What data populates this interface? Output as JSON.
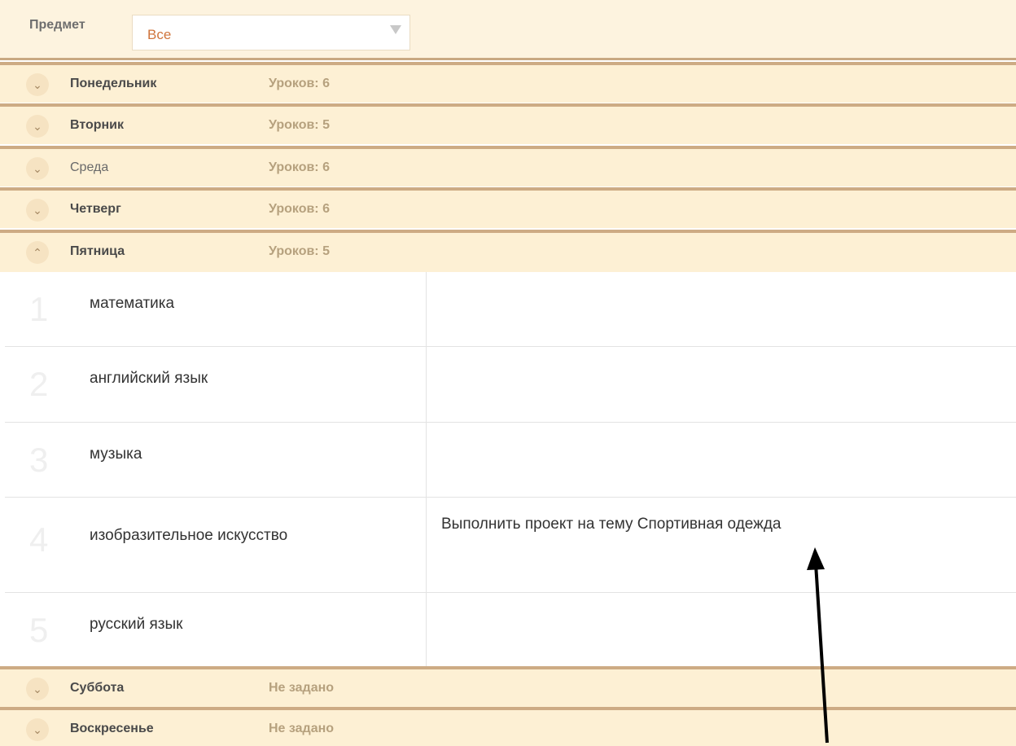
{
  "filter": {
    "label": "Предмет",
    "selected": "Все"
  },
  "days": [
    {
      "name": "Понедельник",
      "count": "Уроков: 6",
      "expanded": false
    },
    {
      "name": "Вторник",
      "count": "Уроков: 5",
      "expanded": false
    },
    {
      "name": "Среда",
      "count": "Уроков: 6",
      "expanded": false
    },
    {
      "name": "Четверг",
      "count": "Уроков: 6",
      "expanded": false
    },
    {
      "name": "Пятница",
      "count": "Уроков: 5",
      "expanded": true
    },
    {
      "name": "Суббота",
      "count": "Не задано",
      "expanded": false
    },
    {
      "name": "Воскресенье",
      "count": "Не задано",
      "expanded": false
    }
  ],
  "icons": {
    "collapsed": "chevron-down-icon",
    "expanded": "chevron-up-icon",
    "chevron_down_glyph": "⌄",
    "chevron_up_glyph": "⌃"
  },
  "lessons": [
    {
      "num": "1",
      "subject": "математика",
      "homework": ""
    },
    {
      "num": "2",
      "subject": "английский язык",
      "homework": ""
    },
    {
      "num": "3",
      "subject": "музыка",
      "homework": ""
    },
    {
      "num": "4",
      "subject": "изобразительное искусство",
      "homework": "Выполнить проект на тему Спортивная одежда"
    },
    {
      "num": "5",
      "subject": "русский язык",
      "homework": ""
    }
  ],
  "colors": {
    "header_bg": "#fdf0d4",
    "header_border": "#cdab84",
    "count_text": "#b6a17e",
    "select_value": "#d0743c"
  }
}
